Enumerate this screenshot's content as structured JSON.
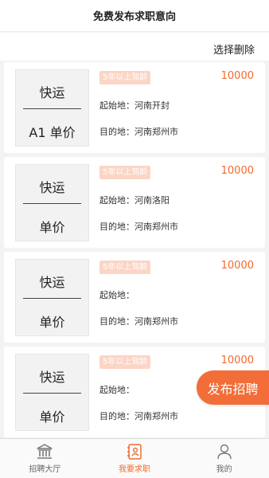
{
  "header": {
    "title": "免费发布求职意向"
  },
  "toolbar": {
    "select_delete_label": "选择删除"
  },
  "cards": [
    {
      "box_top": "快运",
      "box_bottom": "A1 单价",
      "tag": "5年以上驾龄",
      "salary": "10000",
      "origin": "起始地：河南开封",
      "destination": "目的地：河南郑州市"
    },
    {
      "box_top": "快运",
      "box_bottom": "单价",
      "tag": "5年以上驾龄",
      "salary": "10000",
      "origin": "起始地：河南洛阳",
      "destination": "目的地：河南郑州市"
    },
    {
      "box_top": "快运",
      "box_bottom": "单价",
      "tag": "5年以上驾龄",
      "salary": "10000",
      "origin": "起始地：",
      "destination": "目的地：河南郑州市"
    },
    {
      "box_top": "快运",
      "box_bottom": "单价",
      "tag": "5年以上驾龄",
      "salary": "10000",
      "origin": "起始地：",
      "destination": "目的地：河南郑州市"
    }
  ],
  "fab": {
    "label": "发布招聘"
  },
  "tabs": [
    {
      "label": "招聘大厅",
      "icon": "bank-icon"
    },
    {
      "label": "我要求职",
      "icon": "resume-icon"
    },
    {
      "label": "我的",
      "icon": "person-icon"
    }
  ],
  "colors": {
    "accent": "#f26a2e",
    "tag_bg": "#fbd5c5",
    "page_bg": "#f3f3f3"
  }
}
